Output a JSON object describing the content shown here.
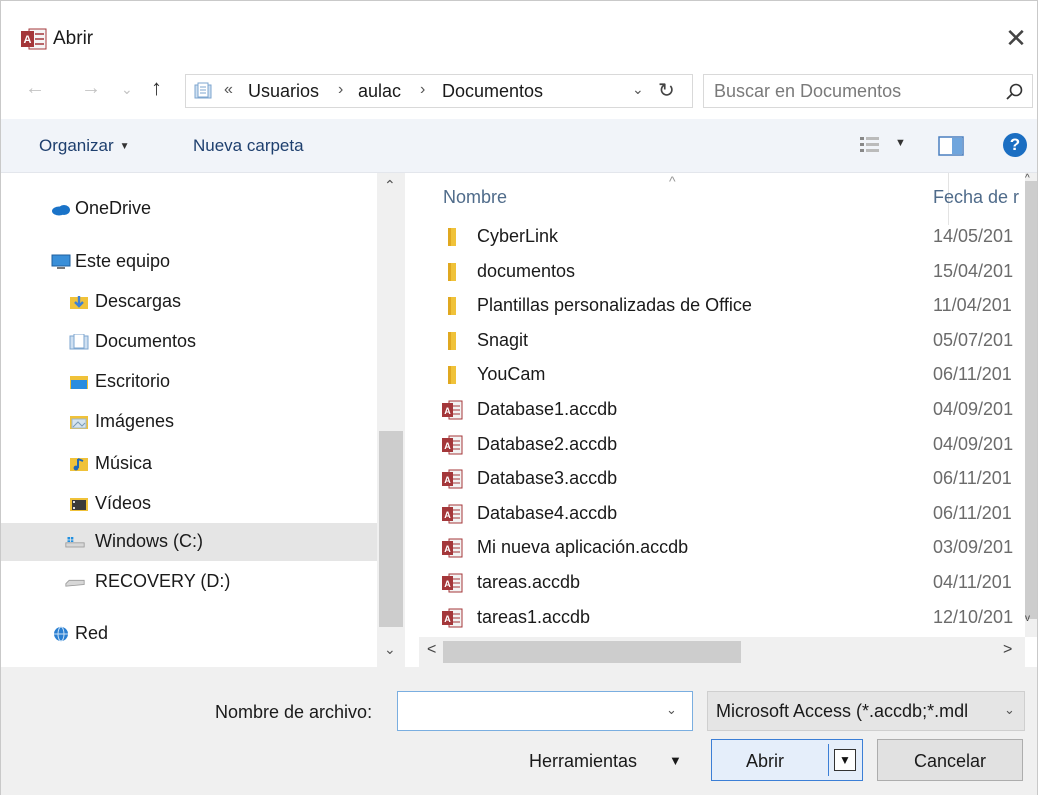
{
  "window": {
    "title": "Abrir",
    "close_glyph": "✕"
  },
  "nav": {
    "back_glyph": "←",
    "forward_glyph": "→",
    "recent_glyph": "⌄",
    "up_glyph": "↑",
    "address_overflow": "«",
    "address_segments": [
      "Usuarios",
      "aulac",
      "Documentos"
    ],
    "address_separator": "›",
    "dropdown_glyph": "⌄",
    "refresh_glyph": "↻",
    "search_placeholder": "Buscar en Documentos"
  },
  "toolbar": {
    "organize_label": "Organizar",
    "new_folder_label": "Nueva carpeta",
    "caret_glyph": "▼",
    "help_glyph": "?"
  },
  "sidebar": {
    "items": [
      {
        "label": "OneDrive",
        "icon": "onedrive-icon",
        "color": "#1a73c8"
      },
      {
        "label": "Este equipo",
        "icon": "computer-icon",
        "color": "#3a8fd8"
      },
      {
        "label": "Descargas",
        "icon": "downloads-folder-icon",
        "color": "#3c7fd6"
      },
      {
        "label": "Documentos",
        "icon": "documents-folder-icon",
        "color": "#8fb3d9"
      },
      {
        "label": "Escritorio",
        "icon": "desktop-folder-icon",
        "color": "#2a8de0"
      },
      {
        "label": "Imágenes",
        "icon": "pictures-folder-icon",
        "color": "#9fb8cc"
      },
      {
        "label": "Música",
        "icon": "music-folder-icon",
        "color": "#1f67b8"
      },
      {
        "label": "Vídeos",
        "icon": "videos-folder-icon",
        "color": "#3a3a3a"
      },
      {
        "label": "Windows (C:)",
        "icon": "system-drive-icon",
        "color": "#9a9a9a",
        "selected": true
      },
      {
        "label": "RECOVERY (D:)",
        "icon": "drive-icon",
        "color": "#9a9a9a"
      },
      {
        "label": "Red",
        "icon": "network-icon",
        "color": "#2b7fd1"
      }
    ],
    "scroll_up_glyph": "⌃",
    "scroll_down_glyph": "⌄"
  },
  "files": {
    "columns": {
      "name": "Nombre",
      "date": "Fecha de r"
    },
    "sort_glyph": "^",
    "rows": [
      {
        "name": "CyberLink",
        "date": "14/05/201",
        "type": "folder"
      },
      {
        "name": "documentos",
        "date": "15/04/201",
        "type": "folder"
      },
      {
        "name": "Plantillas personalizadas de Office",
        "date": "11/04/201",
        "type": "folder"
      },
      {
        "name": "Snagit",
        "date": "05/07/201",
        "type": "folder"
      },
      {
        "name": "YouCam",
        "date": "06/11/201",
        "type": "folder"
      },
      {
        "name": "Database1.accdb",
        "date": "04/09/201",
        "type": "access"
      },
      {
        "name": "Database2.accdb",
        "date": "04/09/201",
        "type": "access"
      },
      {
        "name": "Database3.accdb",
        "date": "06/11/201",
        "type": "access"
      },
      {
        "name": "Database4.accdb",
        "date": "06/11/201",
        "type": "access"
      },
      {
        "name": "Mi nueva aplicación.accdb",
        "date": "03/09/201",
        "type": "access"
      },
      {
        "name": "tareas.accdb",
        "date": "04/11/201",
        "type": "access"
      },
      {
        "name": "tareas1.accdb",
        "date": "12/10/201",
        "type": "access"
      }
    ],
    "h_left_glyph": "<",
    "h_right_glyph": ">",
    "v_up_glyph": "^",
    "v_down_glyph": "v"
  },
  "bottom": {
    "filename_label": "Nombre de archivo:",
    "filename_value": "",
    "filename_caret": "⌄",
    "filetype_value": "Microsoft Access (*.accdb;*.mdl",
    "filetype_caret": "⌄",
    "tools_label": "Herramientas",
    "tools_caret": "▼",
    "open_label": "Abrir",
    "open_caret": "▼",
    "cancel_label": "Cancelar"
  },
  "colors": {
    "access_red": "#a4373a",
    "folder_yellow": "#f0c239",
    "accent_blue": "#3c7fd6"
  }
}
